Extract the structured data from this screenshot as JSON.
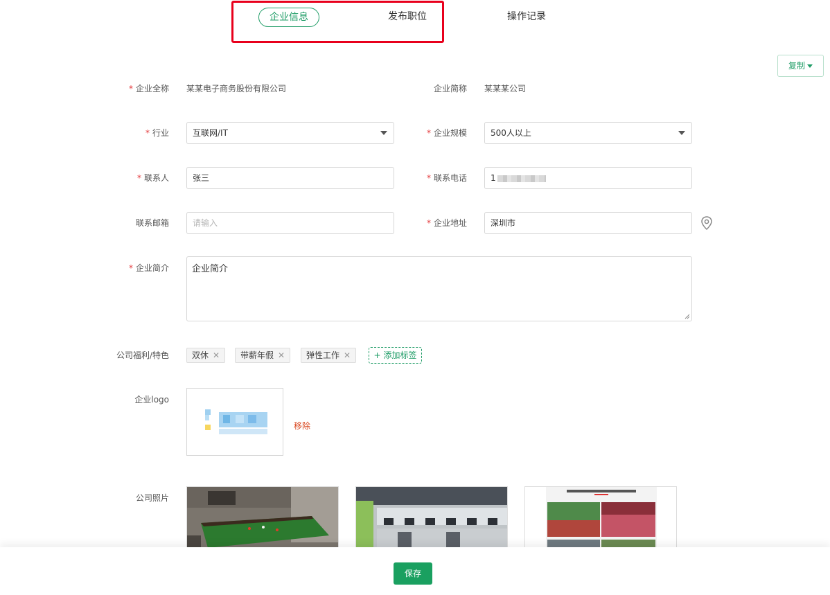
{
  "tabs": [
    {
      "label": "企业信息",
      "active": true
    },
    {
      "label": "发布职位",
      "active": false
    },
    {
      "label": "操作记录",
      "active": false
    }
  ],
  "copy_button": {
    "label": "复制"
  },
  "form": {
    "full_name": {
      "label": "企业全称",
      "required": true,
      "value": "某某电子商务股份有限公司"
    },
    "short_name": {
      "label": "企业简称",
      "required": false,
      "value": "某某某公司"
    },
    "industry": {
      "label": "行业",
      "required": true,
      "value": "互联网/IT"
    },
    "scale": {
      "label": "企业规模",
      "required": true,
      "value": "500人以上"
    },
    "contact": {
      "label": "联系人",
      "required": true,
      "value": "张三"
    },
    "phone": {
      "label": "联系电话",
      "required": true,
      "value": "1"
    },
    "email": {
      "label": "联系邮箱",
      "required": false,
      "value": "",
      "placeholder": "请输入"
    },
    "address": {
      "label": "企业地址",
      "required": true,
      "value": "深圳市"
    },
    "intro": {
      "label": "企业简介",
      "required": true,
      "value": "企业简介"
    },
    "benefits": {
      "label": "公司福利/特色",
      "tags": [
        "双休",
        "带薪年假",
        "弹性工作"
      ],
      "add_label": "添加标签"
    },
    "logo": {
      "label": "企业logo",
      "remove_label": "移除"
    },
    "photos": {
      "label": "公司照片"
    }
  },
  "save_button": {
    "label": "保存"
  },
  "colors": {
    "accent": "#1e9c66",
    "required": "#e4393c",
    "highlight": "#e8001c",
    "remove": "#d9471f"
  }
}
